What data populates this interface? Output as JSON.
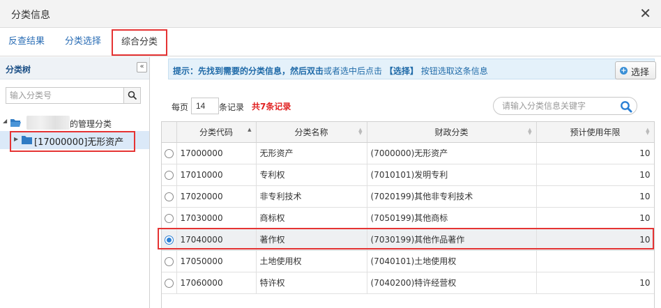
{
  "window": {
    "title": "分类信息",
    "close_glyph": "✕"
  },
  "tabs": [
    {
      "label": "反查结果",
      "active": false
    },
    {
      "label": "分类选择",
      "active": false
    },
    {
      "label": "综合分类",
      "active": true
    }
  ],
  "sidebar": {
    "title": "分类树",
    "collapse_glyph": "«",
    "search_placeholder": "输入分类号",
    "tree": {
      "root_label": "的管理分类",
      "child_label": "[17000000]无形资产"
    }
  },
  "tip": {
    "prefix": "提示：先找到需要的分类信息，然后",
    "bold1": "双击",
    "middle": "或者选中后点击",
    "bold2": "【选择】",
    "suffix": "按钮选取这条信息"
  },
  "select_button": {
    "icon": "plus-circle-icon",
    "label": "选择"
  },
  "pager": {
    "per_page_label": "每页",
    "per_page_value": "14",
    "records_label": "条记录",
    "total_text": "共7条记录"
  },
  "keyword_search": {
    "placeholder": "请输入分类信息关键字",
    "icon": "search-icon"
  },
  "table": {
    "columns": [
      "",
      "分类代码",
      "分类名称",
      "财政分类",
      "预计使用年限"
    ],
    "rows": [
      {
        "selected": false,
        "code": "17000000",
        "name": "无形资产",
        "fiscal": "(7000000)无形资产",
        "years": "10"
      },
      {
        "selected": false,
        "code": "17010000",
        "name": "专利权",
        "fiscal": "(7010101)发明专利",
        "years": "10"
      },
      {
        "selected": false,
        "code": "17020000",
        "name": "非专利技术",
        "fiscal": "(7020199)其他非专利技术",
        "years": "10"
      },
      {
        "selected": false,
        "code": "17030000",
        "name": "商标权",
        "fiscal": "(7050199)其他商标",
        "years": "10"
      },
      {
        "selected": true,
        "code": "17040000",
        "name": "著作权",
        "fiscal": "(7030199)其他作品著作",
        "years": "10"
      },
      {
        "selected": false,
        "code": "17050000",
        "name": "土地使用权",
        "fiscal": "(7040101)土地使用权",
        "years": ""
      },
      {
        "selected": false,
        "code": "17060000",
        "name": "特许权",
        "fiscal": "(7040200)特许经营权",
        "years": "10"
      }
    ]
  },
  "colors": {
    "accent_blue": "#2a6db5",
    "highlight_red": "#e53333",
    "total_red": "#e02020"
  }
}
